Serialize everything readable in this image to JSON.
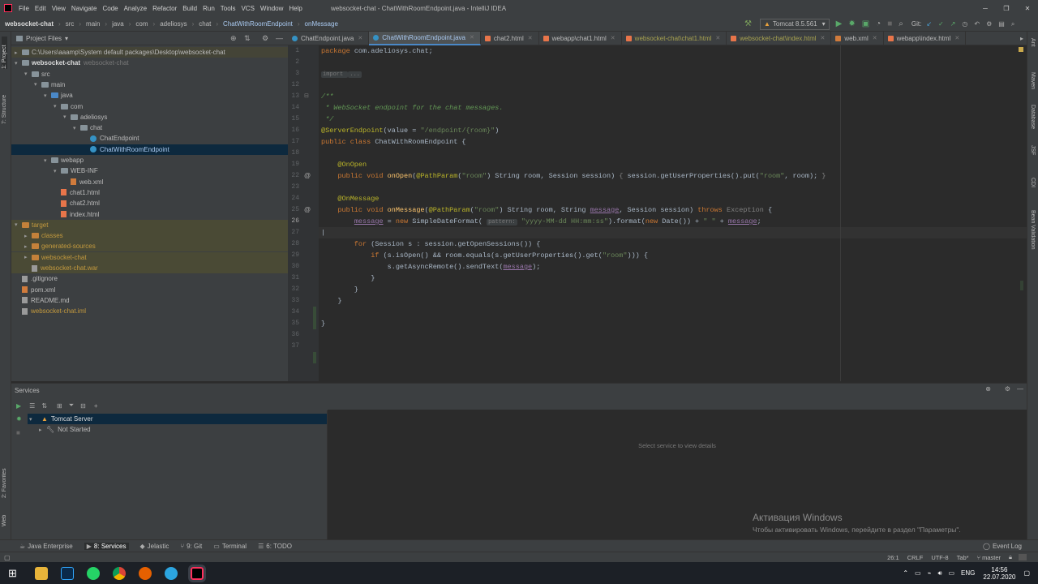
{
  "window": {
    "title": "websocket-chat - ChatWithRoomEndpoint.java - IntelliJ IDEA",
    "menu": [
      "File",
      "Edit",
      "View",
      "Navigate",
      "Code",
      "Analyze",
      "Refactor",
      "Build",
      "Run",
      "Tools",
      "VCS",
      "Window",
      "Help"
    ]
  },
  "nav": {
    "crumbs": [
      "websocket-chat",
      "src",
      "main",
      "java",
      "com",
      "adeliosys",
      "chat",
      "ChatWithRoomEndpoint",
      "onMessage"
    ],
    "run_config": "Tomcat 8.5.561",
    "git_label": "Git:"
  },
  "left_strip": {
    "project": "1: Project",
    "structure": "7: Structure",
    "favorites": "2: Favorites",
    "web": "Web"
  },
  "right_strip": [
    "Ant",
    "Maven",
    "Database",
    "JSF",
    "CDI",
    "Bean Validation"
  ],
  "project": {
    "header": "Project Files",
    "nodes": [
      {
        "label": "C:\\Users\\aaamp\\System default packages\\Desktop\\websocket-chat",
        "kind": "folder",
        "arrow": "▸",
        "style": "highlight"
      },
      {
        "label": "websocket-chat",
        "suffix": "websocket-chat",
        "kind": "folder",
        "arrow": "▾",
        "style": "bold"
      },
      {
        "label": "src",
        "kind": "folder",
        "arrow": "▾"
      },
      {
        "label": "main",
        "kind": "folder",
        "arrow": "▾"
      },
      {
        "label": "java",
        "kind": "folder-blue",
        "arrow": "▾"
      },
      {
        "label": "com",
        "kind": "folder",
        "arrow": "▾"
      },
      {
        "label": "adeliosys",
        "kind": "folder",
        "arrow": "▾"
      },
      {
        "label": "chat",
        "kind": "folder",
        "arrow": "▾"
      },
      {
        "label": "ChatEndpoint",
        "kind": "class",
        "arrow": ""
      },
      {
        "label": "ChatWithRoomEndpoint",
        "kind": "class",
        "arrow": "",
        "style": "selected"
      },
      {
        "label": "webapp",
        "kind": "folder",
        "arrow": "▾"
      },
      {
        "label": "WEB-INF",
        "kind": "folder",
        "arrow": "▾"
      },
      {
        "label": "web.xml",
        "kind": "xml",
        "arrow": ""
      },
      {
        "label": "chat1.html",
        "kind": "html",
        "arrow": ""
      },
      {
        "label": "chat2.html",
        "kind": "html",
        "arrow": ""
      },
      {
        "label": "index.html",
        "kind": "html",
        "arrow": ""
      },
      {
        "label": "target",
        "kind": "folder-orange",
        "arrow": "▾",
        "style": "excluded"
      },
      {
        "label": "classes",
        "kind": "folder-orange",
        "arrow": "▸",
        "style": "excluded"
      },
      {
        "label": "generated-sources",
        "kind": "folder-orange",
        "arrow": "▸",
        "style": "excluded"
      },
      {
        "label": "websocket-chat",
        "kind": "folder-orange",
        "arrow": "▸",
        "style": "excluded"
      },
      {
        "label": "websocket-chat.war",
        "kind": "file",
        "arrow": "",
        "style": "excluded"
      },
      {
        "label": ".gitignore",
        "kind": "file",
        "arrow": ""
      },
      {
        "label": "pom.xml",
        "kind": "xml",
        "arrow": ""
      },
      {
        "label": "README.md",
        "kind": "file",
        "arrow": ""
      },
      {
        "label": "websocket-chat.iml",
        "kind": "file",
        "arrow": "",
        "style": "yellow"
      }
    ],
    "depths": [
      0,
      0,
      1,
      2,
      3,
      4,
      5,
      6,
      7,
      7,
      3,
      4,
      5,
      4,
      4,
      4,
      0,
      1,
      1,
      1,
      1,
      0,
      0,
      0,
      0
    ]
  },
  "editor": {
    "tabs": [
      {
        "label": "ChatEndpoint.java",
        "state": "normal"
      },
      {
        "label": "ChatWithRoomEndpoint.java",
        "state": "active"
      },
      {
        "label": "chat2.html",
        "state": "normal"
      },
      {
        "label": "webapp\\chat1.html",
        "state": "normal"
      },
      {
        "label": "websocket-chat\\chat1.html",
        "state": "mod"
      },
      {
        "label": "websocket-chat\\index.html",
        "state": "mod"
      },
      {
        "label": "web.xml",
        "state": "normal"
      },
      {
        "label": "webapp\\index.html",
        "state": "normal"
      }
    ],
    "line_numbers": [
      "1",
      "2",
      "3",
      "12",
      "13",
      "14",
      "15",
      "16",
      "17",
      "18",
      "19",
      "22",
      "23",
      "24",
      "25",
      "26",
      "27",
      "28",
      "29",
      "30",
      "31",
      "32",
      "33",
      "34",
      "35",
      "36",
      "37"
    ]
  },
  "services": {
    "title": "Services",
    "server": "Tomcat Server",
    "status": "Not Started",
    "placeholder": "Select service to view details"
  },
  "activation": {
    "title": "Активация Windows",
    "text": "Чтобы активировать Windows, перейдите в раздел \"Параметры\"."
  },
  "toolwindows": [
    "Java Enterprise",
    "8: Services",
    "Jelastic",
    "9: Git",
    "Terminal",
    "6: TODO"
  ],
  "event_log": "Event Log",
  "status": {
    "position": "26:1",
    "line_sep": "CRLF",
    "encoding": "UTF-8",
    "indent": "Tab*",
    "branch": "master"
  },
  "taskbar": {
    "lang": "ENG",
    "time": "14:56",
    "date": "22.07.2020"
  }
}
